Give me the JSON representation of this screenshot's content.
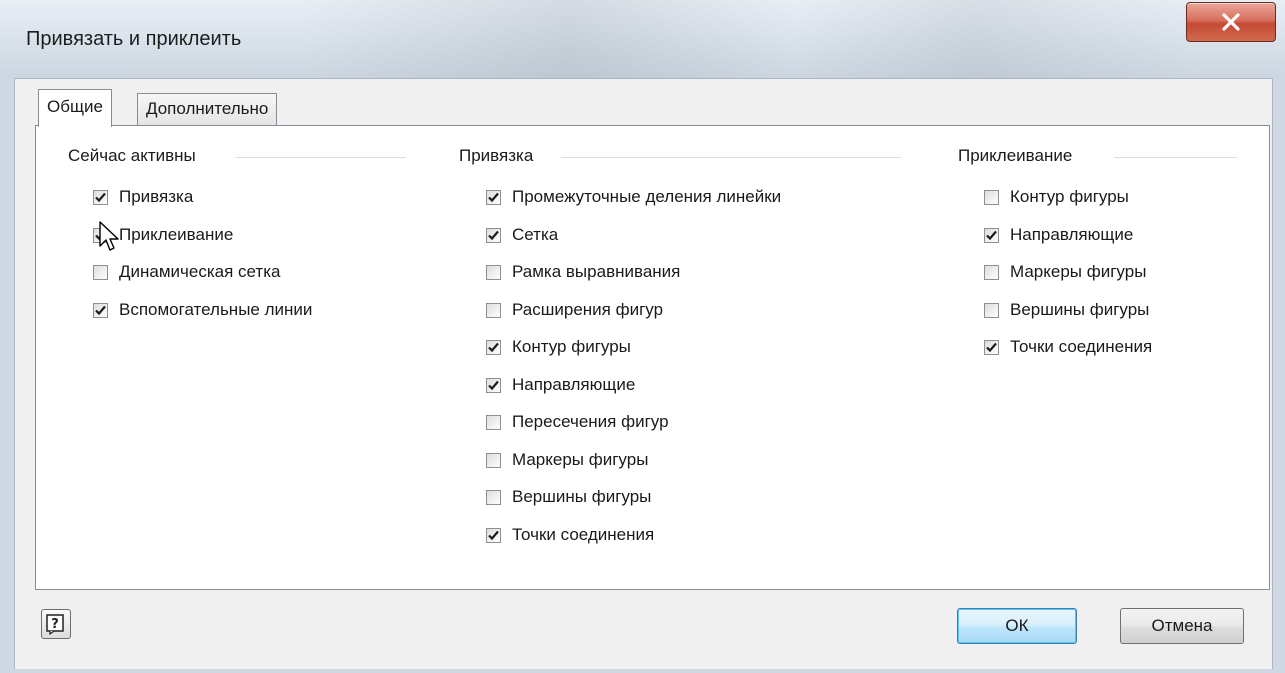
{
  "window": {
    "title": "Привязать и приклеить",
    "close_glyph": "x"
  },
  "tabs": [
    {
      "label": "Общие",
      "active": true
    },
    {
      "label": "Дополнительно",
      "active": false
    }
  ],
  "groups": {
    "active_now": {
      "title": "Сейчас активны",
      "items": [
        {
          "label": "Привязка",
          "checked": true
        },
        {
          "label": "Приклеивание",
          "checked": true
        },
        {
          "label": "Динамическая сетка",
          "checked": false
        },
        {
          "label": "Вспомогательные линии",
          "checked": true
        }
      ]
    },
    "snap": {
      "title": "Привязка",
      "items": [
        {
          "label": "Промежуточные деления линейки",
          "checked": true
        },
        {
          "label": "Сетка",
          "checked": true
        },
        {
          "label": "Рамка выравнивания",
          "checked": false
        },
        {
          "label": "Расширения фигур",
          "checked": false
        },
        {
          "label": "Контур фигуры",
          "checked": true
        },
        {
          "label": "Направляющие",
          "checked": true
        },
        {
          "label": "Пересечения фигур",
          "checked": false
        },
        {
          "label": "Маркеры фигуры",
          "checked": false
        },
        {
          "label": "Вершины фигуры",
          "checked": false
        },
        {
          "label": "Точки соединения",
          "checked": true
        }
      ]
    },
    "glue": {
      "title": "Приклеивание",
      "items": [
        {
          "label": "Контур фигуры",
          "checked": false
        },
        {
          "label": "Направляющие",
          "checked": true
        },
        {
          "label": "Маркеры фигуры",
          "checked": false
        },
        {
          "label": "Вершины фигуры",
          "checked": false
        },
        {
          "label": "Точки соединения",
          "checked": true
        }
      ]
    }
  },
  "footer": {
    "help_glyph": "?",
    "ok_label": "ОК",
    "cancel_label": "Отмена"
  },
  "colors": {
    "ok_border": "#3c7fb1",
    "close_red": "#c44a34",
    "panel_bg": "#ffffff",
    "dialog_bg": "#f0f0f0"
  },
  "icons": {
    "close": "close-icon",
    "help": "help-icon",
    "check": "checkmark-icon",
    "cursor": "mouse-pointer-icon"
  }
}
